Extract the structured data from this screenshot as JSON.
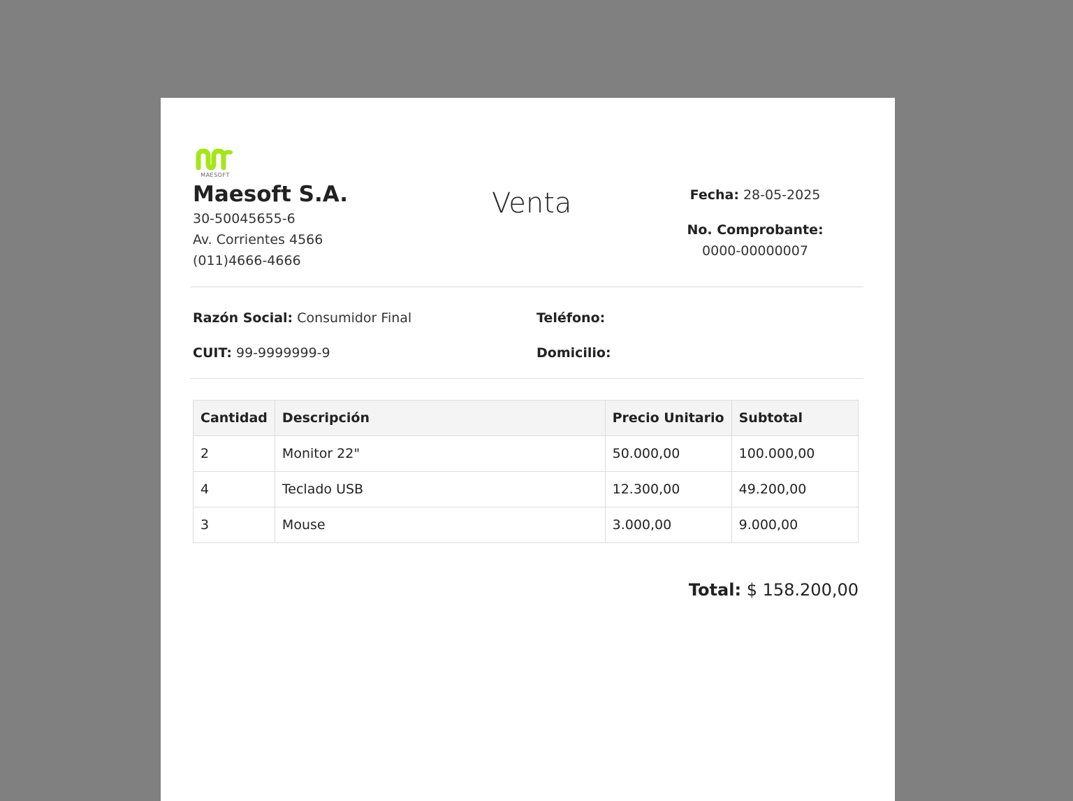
{
  "company": {
    "logo_text": "MAESOFT",
    "logo_color": "#a6e51a",
    "name": "Maesoft S.A.",
    "cuit": "30-50045655-6",
    "address": "Av. Corrientes 4566",
    "phone": "(011)4666-4666"
  },
  "document": {
    "title": "Venta",
    "date_label": "Fecha:",
    "date_value": "28-05-2025",
    "number_label": "No. Comprobante:",
    "number_value": "0000-00000007"
  },
  "client": {
    "business_name_label": "Razón Social:",
    "business_name_value": "Consumidor Final",
    "cuit_label": "CUIT:",
    "cuit_value": "99-9999999-9",
    "phone_label": "Teléfono:",
    "phone_value": "",
    "address_label": "Domicilio:",
    "address_value": ""
  },
  "items": {
    "headers": [
      "Cantidad",
      "Descripción",
      "Precio Unitario",
      "Subtotal"
    ],
    "rows": [
      {
        "qty": "2",
        "description": "Monitor 22\"",
        "unit_price": "50.000,00",
        "subtotal": "100.000,00"
      },
      {
        "qty": "4",
        "description": "Teclado USB",
        "unit_price": "12.300,00",
        "subtotal": "49.200,00"
      },
      {
        "qty": "3",
        "description": "Mouse",
        "unit_price": "3.000,00",
        "subtotal": "9.000,00"
      }
    ]
  },
  "total": {
    "label": "Total:",
    "value": "$ 158.200,00"
  }
}
